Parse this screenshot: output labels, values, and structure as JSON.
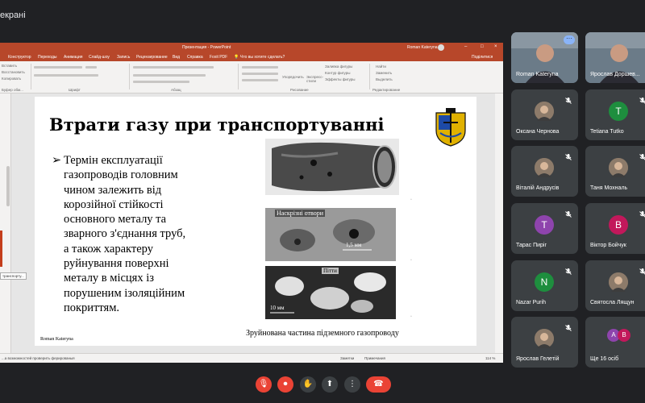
{
  "meet": {
    "top_label": "екрані",
    "colors": {
      "background": "#202124",
      "tile": "#3c4043",
      "danger": "#ea4335",
      "accent": "#8ab4f8"
    }
  },
  "ppt": {
    "window_title": "Презентация - PowerPoint",
    "account_name": "Roman Kateryna",
    "share_label": "Поділитися",
    "tabs": [
      "Конструктор",
      "Переходы",
      "Анимация",
      "Слайд-шоу",
      "Запись",
      "Рецензирование",
      "Вид",
      "Справка",
      "Foxit PDF"
    ],
    "search_hint": "Что вы хотите сделать?",
    "ribbon": {
      "clipboard_items": [
        "Вставить",
        "Восстановить",
        "Копировать"
      ],
      "clipboard_group": "Буфер обм...",
      "font_group": "Шрифт",
      "paragraph_group": "Абзац",
      "drawing_group": "Рисование",
      "arrange_label": "Упорядочить",
      "quick_styles_label": "Экспресс-стили",
      "shape_fill": "Заливка фигуры",
      "shape_outline": "Контур фигуры",
      "shape_effects": "Эффекты фигуры",
      "find": "Найти",
      "replace": "Заменить",
      "select": "Выделить",
      "editing_group": "Редактирование"
    },
    "thumbnail_label": "транспорту...",
    "status": {
      "left": "...а возможностей проверить ферированыя",
      "notes": "Заметки",
      "comments": "Примечания",
      "zoom": "114 %"
    },
    "accent": "#b7472a"
  },
  "slide": {
    "title": "Втрати газу при транспортуванні",
    "bullet_marker": "➢",
    "body_lines": [
      "Термін експлуатації",
      "газопроводів головним",
      "чином залежить від",
      "корозійної стійкості",
      "основного металу та",
      "зварного з'єднання труб,",
      "а також характеру",
      "руйнування поверхні",
      "металу в місцях із",
      "порушеним ізоляційним",
      "покриттям."
    ],
    "photo1_captions": [
      "Наскрізні отвори",
      "1,5 мм"
    ],
    "photo2_captions": [
      "Наскрізні отвори",
      "1,5 мм"
    ],
    "photo3_captions": [
      "Пітти",
      "10 мм"
    ],
    "photo_caption": "Зруйнована частина підземного газопроводу",
    "footer": "Roman Kateryna",
    "crest_colors": {
      "gold": "#e0b100",
      "blue": "#1d4aa7",
      "black": "#111111"
    }
  },
  "participants": [
    {
      "name": "Roman Kateryna",
      "kind": "video",
      "active": true
    },
    {
      "name": "Ярослав Доршев...",
      "kind": "video"
    },
    {
      "name": "Оксана Чернова",
      "kind": "photo",
      "muted": true
    },
    {
      "name": "Tetiana Tutko",
      "kind": "letter",
      "letter": "T",
      "color": "#1e8e3e",
      "muted": true
    },
    {
      "name": "Віталій Андрусів",
      "kind": "photo",
      "muted": true
    },
    {
      "name": "Таня Мохналь",
      "kind": "photo",
      "muted": true
    },
    {
      "name": "Тарас Пиріг",
      "kind": "letter",
      "letter": "T",
      "color": "#8e44ad",
      "muted": true
    },
    {
      "name": "Віктор Бойчук",
      "kind": "letter",
      "letter": "B",
      "color": "#c2185b",
      "muted": true
    },
    {
      "name": "Nazar Purih",
      "kind": "letter",
      "letter": "N",
      "color": "#1e8e3e",
      "muted": true
    },
    {
      "name": "Святосла Лящун",
      "kind": "photo",
      "muted": true
    },
    {
      "name": "Ярослав Гелетій",
      "kind": "photo",
      "muted": true
    },
    {
      "name": "Ще 16 осіб",
      "kind": "more",
      "letters": [
        "A",
        "B"
      ]
    }
  ],
  "controls": [
    {
      "name": "mic-off",
      "glyph": "🎙",
      "danger": true
    },
    {
      "name": "camera-off",
      "glyph": "⏺",
      "danger": true
    },
    {
      "name": "raise-hand",
      "glyph": "✋",
      "danger": false
    },
    {
      "name": "present",
      "glyph": "⬆",
      "danger": false
    },
    {
      "name": "more-options",
      "glyph": "⋮",
      "danger": false
    },
    {
      "name": "hang-up",
      "glyph": "☎",
      "danger": true
    }
  ]
}
